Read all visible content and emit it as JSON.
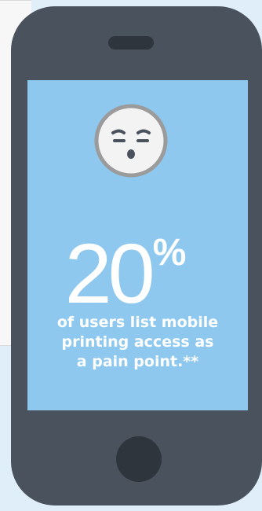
{
  "statistic": {
    "value": "20",
    "unit": "%",
    "caption_lines": [
      "of users list mobile",
      "printing access as",
      "a pain point.**"
    ]
  },
  "icons": {
    "face": "frustrated-face-icon"
  },
  "colors": {
    "background": "#dfeef9",
    "phone_body": "#4a525d",
    "phone_dark": "#2f353d",
    "screen": "#8ec8ef",
    "face_fill": "#f3f3f3",
    "face_stroke": "#9b9b9b",
    "text": "#ffffff"
  }
}
